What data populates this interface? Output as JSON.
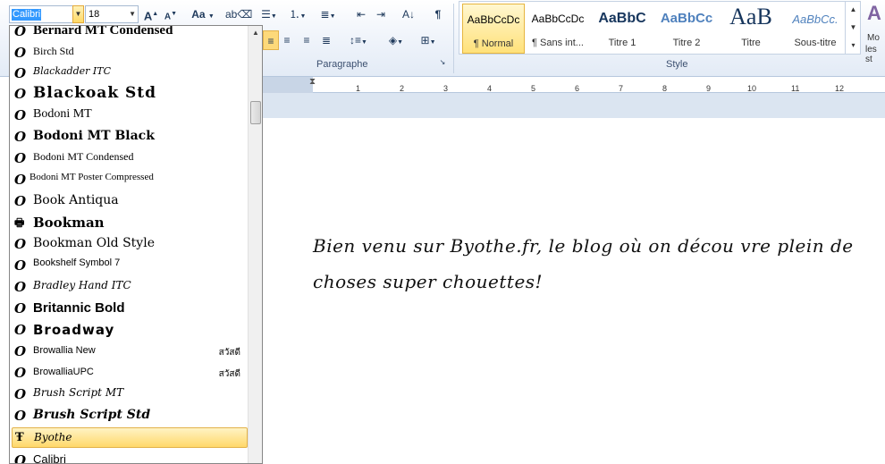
{
  "font_controls": {
    "font_name": "Calibri",
    "font_size": "18",
    "grow_font": "A",
    "shrink_font": "A",
    "change_case": "Aa"
  },
  "paragraph_group": {
    "label": "Paragraphe"
  },
  "styles_group": {
    "label": "Style",
    "items": [
      {
        "preview": "AaBbCcDc",
        "name": "¶ Normal"
      },
      {
        "preview": "AaBbCcDc",
        "name": "¶ Sans int..."
      },
      {
        "preview": "AaBbC",
        "name": "Titre 1"
      },
      {
        "preview": "AaBbCc",
        "name": "Titre 2"
      },
      {
        "preview": "AaB",
        "name": "Titre"
      },
      {
        "preview": "AaBbCc.",
        "name": "Sous-titre"
      }
    ],
    "more_label": "Mo",
    "more_label2": "les st"
  },
  "ruler": {
    "ticks": [
      "1",
      "2",
      "3",
      "4",
      "5",
      "6",
      "7",
      "8",
      "9",
      "10",
      "11",
      "12"
    ]
  },
  "document": {
    "line1": "Bien venu sur Byothe.fr, le blog où on décou vre plein de",
    "line2": "choses super chouettes!"
  },
  "font_list": [
    {
      "name": "Bernard MT Condensed",
      "icon": "O"
    },
    {
      "name": "Birch Std",
      "icon": "O"
    },
    {
      "name": "Blackadder ITC",
      "icon": "O"
    },
    {
      "name": "Blackoak Std",
      "icon": "O"
    },
    {
      "name": "Bodoni MT",
      "icon": "O"
    },
    {
      "name": "Bodoni MT Black",
      "icon": "O"
    },
    {
      "name": "Bodoni MT Condensed",
      "icon": "O"
    },
    {
      "name": "Bodoni MT Poster Compressed",
      "icon": "O"
    },
    {
      "name": "Book Antiqua",
      "icon": "O"
    },
    {
      "name": "Bookman",
      "icon": "printer"
    },
    {
      "name": "Bookman Old Style",
      "icon": "O"
    },
    {
      "name": "Bookshelf Symbol 7",
      "icon": "O"
    },
    {
      "name": "Bradley Hand ITC",
      "icon": "O"
    },
    {
      "name": "Britannic Bold",
      "icon": "O"
    },
    {
      "name": "Broadway",
      "icon": "O"
    },
    {
      "name": "Browallia New",
      "icon": "O",
      "sample": "สวัสดี"
    },
    {
      "name": "BrowalliaUPC",
      "icon": "O",
      "sample": "สวัสดี"
    },
    {
      "name": "Brush Script MT",
      "icon": "O"
    },
    {
      "name": "Brush Script Std",
      "icon": "O"
    },
    {
      "name": "Byothe",
      "icon": "T"
    },
    {
      "name": "Calibri",
      "icon": "O"
    }
  ]
}
